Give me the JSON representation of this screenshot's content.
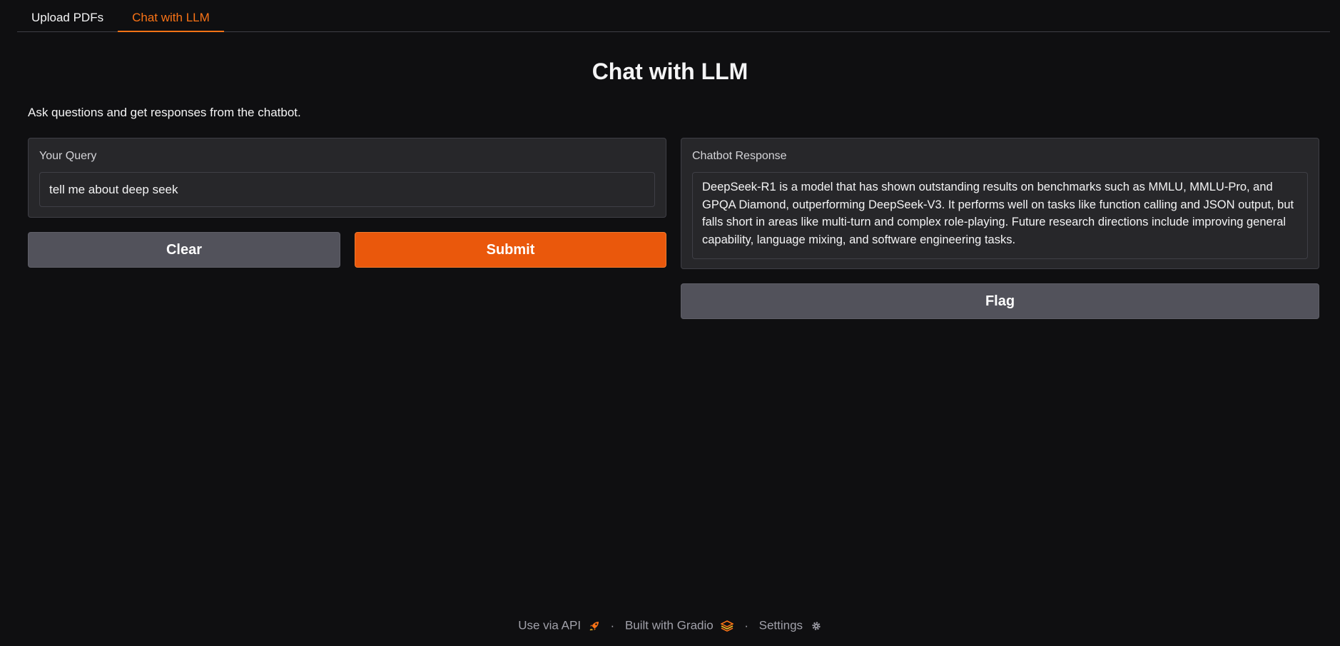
{
  "tabs": [
    {
      "label": "Upload PDFs",
      "active": false
    },
    {
      "label": "Chat with LLM",
      "active": true
    }
  ],
  "page": {
    "title": "Chat with LLM",
    "description": "Ask questions and get responses from the chatbot."
  },
  "query": {
    "label": "Your Query",
    "value": "tell me about deep seek"
  },
  "buttons": {
    "clear": "Clear",
    "submit": "Submit",
    "flag": "Flag"
  },
  "response": {
    "label": "Chatbot Response",
    "text": "DeepSeek-R1 is a model that has shown outstanding results on benchmarks such as MMLU, MMLU-Pro, and GPQA Diamond, outperforming DeepSeek-V3. It performs well on tasks like function calling and JSON output, but falls short in areas like multi-turn and complex role-playing. Future research directions include improving general capability, language mixing, and software engineering tasks."
  },
  "footer": {
    "api": "Use via API",
    "built": "Built with Gradio",
    "settings": "Settings",
    "separator": "·",
    "icons": {
      "api": "rocket-icon",
      "built": "gradio-logo-icon",
      "settings": "gear-icon"
    }
  },
  "colors": {
    "accent": "#f97316",
    "primary_button": "#ea580c",
    "secondary_button": "#52525b",
    "background": "#0f0f11",
    "panel": "#27272a"
  }
}
